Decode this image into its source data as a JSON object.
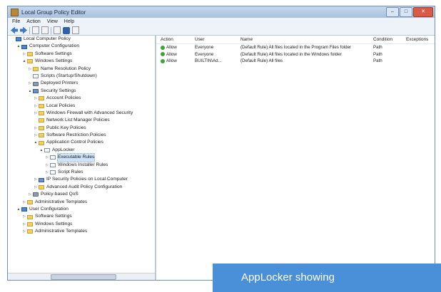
{
  "window": {
    "title": "Local Group Policy Editor"
  },
  "menu": [
    "File",
    "Action",
    "View",
    "Help"
  ],
  "tree": [
    {
      "label": "Local Computer Policy",
      "depth": 0,
      "icon": "pc-icon",
      "exp": ""
    },
    {
      "label": "Computer Configuration",
      "depth": 1,
      "icon": "pc-icon",
      "exp": "▲"
    },
    {
      "label": "Software Settings",
      "depth": 2,
      "icon": "folder-icon",
      "exp": "▷"
    },
    {
      "label": "Windows Settings",
      "depth": 2,
      "icon": "folder-icon",
      "exp": "▲"
    },
    {
      "label": "Name Resolution Policy",
      "depth": 3,
      "icon": "folder-icon",
      "exp": "▷"
    },
    {
      "label": "Scripts (Startup/Shutdown)",
      "depth": 3,
      "icon": "doc-icon",
      "exp": ""
    },
    {
      "label": "Deployed Printers",
      "depth": 3,
      "icon": "gear-icon",
      "exp": "▷"
    },
    {
      "label": "Security Settings",
      "depth": 3,
      "icon": "shield-icon",
      "exp": "▲"
    },
    {
      "label": "Account Policies",
      "depth": 4,
      "icon": "folder-icon",
      "exp": "▷"
    },
    {
      "label": "Local Policies",
      "depth": 4,
      "icon": "folder-icon",
      "exp": "▷"
    },
    {
      "label": "Windows Firewall with Advanced Security",
      "depth": 4,
      "icon": "folder-icon",
      "exp": "▷"
    },
    {
      "label": "Network List Manager Policies",
      "depth": 4,
      "icon": "folder-icon",
      "exp": ""
    },
    {
      "label": "Public Key Policies",
      "depth": 4,
      "icon": "folder-icon",
      "exp": "▷"
    },
    {
      "label": "Software Restriction Policies",
      "depth": 4,
      "icon": "folder-icon",
      "exp": "▷"
    },
    {
      "label": "Application Control Policies",
      "depth": 4,
      "icon": "folder-icon",
      "exp": "▲"
    },
    {
      "label": "AppLocker",
      "depth": 5,
      "icon": "doc-icon",
      "exp": "▲"
    },
    {
      "label": "Executable Rules",
      "depth": 6,
      "icon": "doc-icon",
      "exp": "▷",
      "selected": true
    },
    {
      "label": "Windows Installer Rules",
      "depth": 6,
      "icon": "doc-icon",
      "exp": "▷"
    },
    {
      "label": "Script Rules",
      "depth": 6,
      "icon": "doc-icon",
      "exp": "▷"
    },
    {
      "label": "IP Security Policies on Local Computer",
      "depth": 4,
      "icon": "shield-icon",
      "exp": "▷"
    },
    {
      "label": "Advanced Audit Policy Configuration",
      "depth": 4,
      "icon": "folder-icon",
      "exp": "▷"
    },
    {
      "label": "Policy-based QoS",
      "depth": 3,
      "icon": "gear-icon",
      "exp": "▷"
    },
    {
      "label": "Administrative Templates",
      "depth": 2,
      "icon": "folder-icon",
      "exp": "▷"
    },
    {
      "label": "User Configuration",
      "depth": 1,
      "icon": "pc-icon",
      "exp": "▲"
    },
    {
      "label": "Software Settings",
      "depth": 2,
      "icon": "folder-icon",
      "exp": "▷"
    },
    {
      "label": "Windows Settings",
      "depth": 2,
      "icon": "folder-icon",
      "exp": "▷"
    },
    {
      "label": "Administrative Templates",
      "depth": 2,
      "icon": "folder-icon",
      "exp": "▷"
    }
  ],
  "list": {
    "columns": [
      "Action",
      "User",
      "Name",
      "Condition",
      "Exceptions"
    ],
    "rows": [
      [
        "Allow",
        "Everyone",
        "(Default Rule) All files located in the Program Files folder",
        "Path",
        ""
      ],
      [
        "Allow",
        "Everyone",
        "(Default Rule) All files located in the Windows folder",
        "Path",
        ""
      ],
      [
        "Allow",
        "BUILTIN\\Ad...",
        "(Default Rule) All files",
        "Path",
        ""
      ]
    ]
  },
  "caption": "AppLocker showing"
}
